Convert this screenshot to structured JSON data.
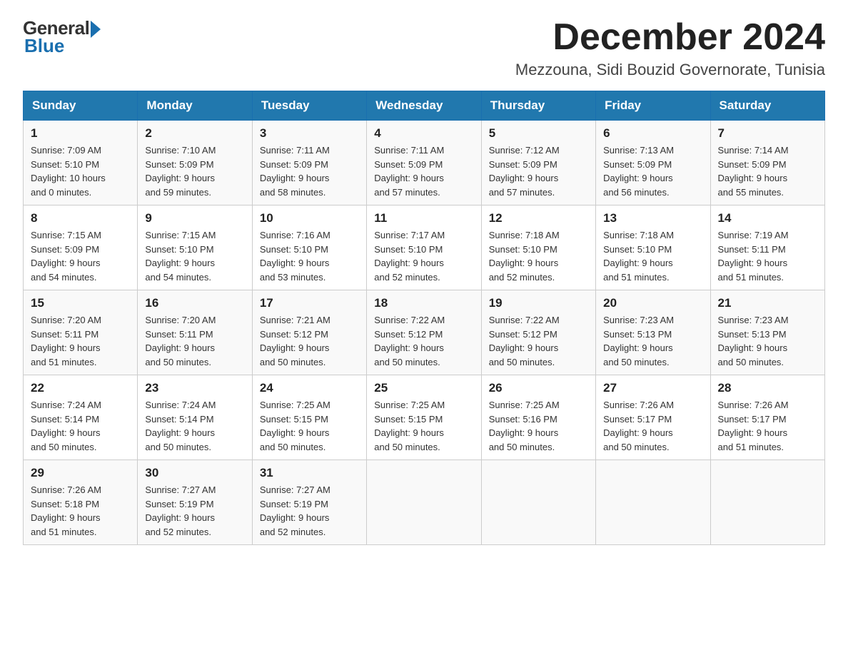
{
  "logo": {
    "general": "General",
    "blue": "Blue"
  },
  "title": {
    "month": "December 2024",
    "location": "Mezzouna, Sidi Bouzid Governorate, Tunisia"
  },
  "weekdays": [
    "Sunday",
    "Monday",
    "Tuesday",
    "Wednesday",
    "Thursday",
    "Friday",
    "Saturday"
  ],
  "weeks": [
    [
      {
        "day": "1",
        "sunrise": "7:09 AM",
        "sunset": "5:10 PM",
        "daylight": "10 hours and 0 minutes."
      },
      {
        "day": "2",
        "sunrise": "7:10 AM",
        "sunset": "5:09 PM",
        "daylight": "9 hours and 59 minutes."
      },
      {
        "day": "3",
        "sunrise": "7:11 AM",
        "sunset": "5:09 PM",
        "daylight": "9 hours and 58 minutes."
      },
      {
        "day": "4",
        "sunrise": "7:11 AM",
        "sunset": "5:09 PM",
        "daylight": "9 hours and 57 minutes."
      },
      {
        "day": "5",
        "sunrise": "7:12 AM",
        "sunset": "5:09 PM",
        "daylight": "9 hours and 57 minutes."
      },
      {
        "day": "6",
        "sunrise": "7:13 AM",
        "sunset": "5:09 PM",
        "daylight": "9 hours and 56 minutes."
      },
      {
        "day": "7",
        "sunrise": "7:14 AM",
        "sunset": "5:09 PM",
        "daylight": "9 hours and 55 minutes."
      }
    ],
    [
      {
        "day": "8",
        "sunrise": "7:15 AM",
        "sunset": "5:09 PM",
        "daylight": "9 hours and 54 minutes."
      },
      {
        "day": "9",
        "sunrise": "7:15 AM",
        "sunset": "5:10 PM",
        "daylight": "9 hours and 54 minutes."
      },
      {
        "day": "10",
        "sunrise": "7:16 AM",
        "sunset": "5:10 PM",
        "daylight": "9 hours and 53 minutes."
      },
      {
        "day": "11",
        "sunrise": "7:17 AM",
        "sunset": "5:10 PM",
        "daylight": "9 hours and 52 minutes."
      },
      {
        "day": "12",
        "sunrise": "7:18 AM",
        "sunset": "5:10 PM",
        "daylight": "9 hours and 52 minutes."
      },
      {
        "day": "13",
        "sunrise": "7:18 AM",
        "sunset": "5:10 PM",
        "daylight": "9 hours and 51 minutes."
      },
      {
        "day": "14",
        "sunrise": "7:19 AM",
        "sunset": "5:11 PM",
        "daylight": "9 hours and 51 minutes."
      }
    ],
    [
      {
        "day": "15",
        "sunrise": "7:20 AM",
        "sunset": "5:11 PM",
        "daylight": "9 hours and 51 minutes."
      },
      {
        "day": "16",
        "sunrise": "7:20 AM",
        "sunset": "5:11 PM",
        "daylight": "9 hours and 50 minutes."
      },
      {
        "day": "17",
        "sunrise": "7:21 AM",
        "sunset": "5:12 PM",
        "daylight": "9 hours and 50 minutes."
      },
      {
        "day": "18",
        "sunrise": "7:22 AM",
        "sunset": "5:12 PM",
        "daylight": "9 hours and 50 minutes."
      },
      {
        "day": "19",
        "sunrise": "7:22 AM",
        "sunset": "5:12 PM",
        "daylight": "9 hours and 50 minutes."
      },
      {
        "day": "20",
        "sunrise": "7:23 AM",
        "sunset": "5:13 PM",
        "daylight": "9 hours and 50 minutes."
      },
      {
        "day": "21",
        "sunrise": "7:23 AM",
        "sunset": "5:13 PM",
        "daylight": "9 hours and 50 minutes."
      }
    ],
    [
      {
        "day": "22",
        "sunrise": "7:24 AM",
        "sunset": "5:14 PM",
        "daylight": "9 hours and 50 minutes."
      },
      {
        "day": "23",
        "sunrise": "7:24 AM",
        "sunset": "5:14 PM",
        "daylight": "9 hours and 50 minutes."
      },
      {
        "day": "24",
        "sunrise": "7:25 AM",
        "sunset": "5:15 PM",
        "daylight": "9 hours and 50 minutes."
      },
      {
        "day": "25",
        "sunrise": "7:25 AM",
        "sunset": "5:15 PM",
        "daylight": "9 hours and 50 minutes."
      },
      {
        "day": "26",
        "sunrise": "7:25 AM",
        "sunset": "5:16 PM",
        "daylight": "9 hours and 50 minutes."
      },
      {
        "day": "27",
        "sunrise": "7:26 AM",
        "sunset": "5:17 PM",
        "daylight": "9 hours and 50 minutes."
      },
      {
        "day": "28",
        "sunrise": "7:26 AM",
        "sunset": "5:17 PM",
        "daylight": "9 hours and 51 minutes."
      }
    ],
    [
      {
        "day": "29",
        "sunrise": "7:26 AM",
        "sunset": "5:18 PM",
        "daylight": "9 hours and 51 minutes."
      },
      {
        "day": "30",
        "sunrise": "7:27 AM",
        "sunset": "5:19 PM",
        "daylight": "9 hours and 52 minutes."
      },
      {
        "day": "31",
        "sunrise": "7:27 AM",
        "sunset": "5:19 PM",
        "daylight": "9 hours and 52 minutes."
      },
      null,
      null,
      null,
      null
    ]
  ],
  "labels": {
    "sunrise": "Sunrise:",
    "sunset": "Sunset:",
    "daylight": "Daylight:"
  }
}
